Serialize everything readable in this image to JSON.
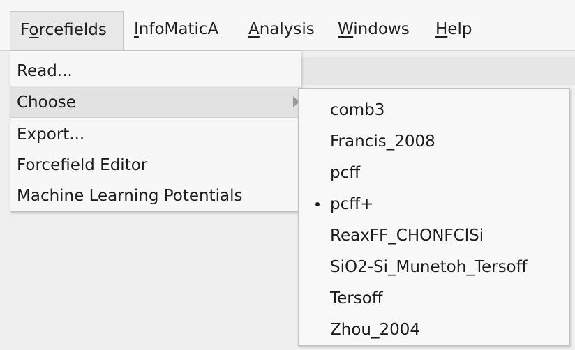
{
  "menubar": {
    "items": [
      {
        "pre": "F",
        "ul": "o",
        "post": "rcefields"
      },
      {
        "pre": "",
        "ul": "I",
        "post": "nfoMaticA"
      },
      {
        "pre": "",
        "ul": "A",
        "post": "nalysis"
      },
      {
        "pre": "",
        "ul": "W",
        "post": "indows"
      },
      {
        "pre": "",
        "ul": "H",
        "post": "elp"
      }
    ]
  },
  "dropdown": {
    "items": [
      {
        "label": "Read..."
      },
      {
        "label": "Choose",
        "has_submenu": true,
        "highlighted": true
      },
      {
        "label": "Export..."
      },
      {
        "label": "Forcefield Editor"
      },
      {
        "label": "Machine Learning Potentials"
      }
    ]
  },
  "submenu": {
    "items": [
      {
        "label": "comb3"
      },
      {
        "label": "Francis_2008"
      },
      {
        "label": "pcff"
      },
      {
        "label": "pcff+",
        "selected": true
      },
      {
        "label": "ReaxFF_CHONFClSi"
      },
      {
        "label": "SiO2-Si_Munetoh_Tersoff"
      },
      {
        "label": "Tersoff"
      },
      {
        "label": "Zhou_2004"
      }
    ]
  },
  "colors": {
    "menubar_bg": "#f7f7f7",
    "active_menu_bg": "#e8e8e8",
    "highlight_bg": "#e2e2e2",
    "window_bg": "#efefef"
  }
}
